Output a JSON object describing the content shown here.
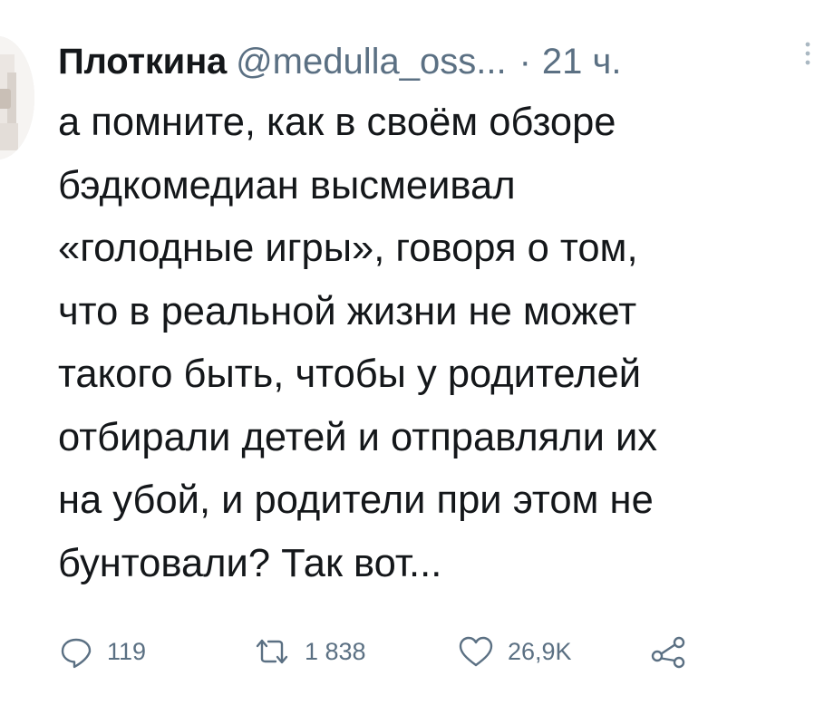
{
  "tweet": {
    "author_name": "Плоткина",
    "author_handle": "@medulla_oss...",
    "separator": "·",
    "timestamp": "21 ч.",
    "text_lines": [
      "а помните, как в своём обзоре",
      "бэдкомедиан высмеивал",
      "«голодные игры», говоря о том,",
      "что в реальной жизни не может",
      "такого быть, чтобы у родителей",
      "отбирали детей и отправляли их",
      "на убой, и родители при этом не",
      "бунтовали? Так вот..."
    ]
  },
  "actions": {
    "reply_count": "119",
    "retweet_count": "1 838",
    "like_count": "26,9K"
  },
  "icons": {
    "reply": "comment-bubble-icon",
    "retweet": "retweet-arrows-icon",
    "like": "heart-outline-icon",
    "share": "share-nodes-icon",
    "more": "more-vertical-dots-icon"
  },
  "colors": {
    "text_primary": "#14171a",
    "text_secondary": "#5b7083",
    "background": "#ffffff"
  }
}
